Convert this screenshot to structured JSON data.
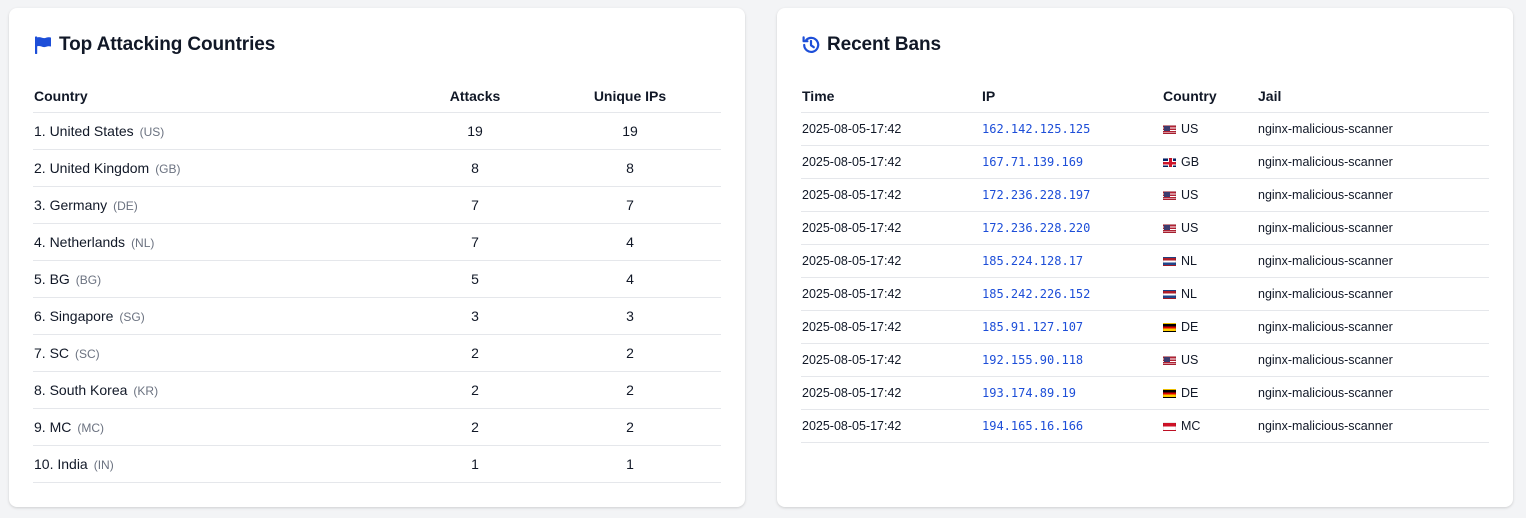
{
  "colors": {
    "accent": "#1d4ed8",
    "muted": "#6b7280",
    "border": "#e5e7eb",
    "background": "#f3f4f6"
  },
  "top_countries": {
    "title": "Top Attacking Countries",
    "icon": "flag-icon",
    "columns": [
      "Country",
      "Attacks",
      "Unique IPs"
    ],
    "rows": [
      {
        "name": "1. United States",
        "code": "(US)",
        "attacks": "19",
        "unique_ips": "19"
      },
      {
        "name": "2. United Kingdom",
        "code": "(GB)",
        "attacks": "8",
        "unique_ips": "8"
      },
      {
        "name": "3. Germany",
        "code": "(DE)",
        "attacks": "7",
        "unique_ips": "7"
      },
      {
        "name": "4. Netherlands",
        "code": "(NL)",
        "attacks": "7",
        "unique_ips": "4"
      },
      {
        "name": "5. BG",
        "code": "(BG)",
        "attacks": "5",
        "unique_ips": "4"
      },
      {
        "name": "6. Singapore",
        "code": "(SG)",
        "attacks": "3",
        "unique_ips": "3"
      },
      {
        "name": "7. SC",
        "code": "(SC)",
        "attacks": "2",
        "unique_ips": "2"
      },
      {
        "name": "8. South Korea",
        "code": "(KR)",
        "attacks": "2",
        "unique_ips": "2"
      },
      {
        "name": "9. MC",
        "code": "(MC)",
        "attacks": "2",
        "unique_ips": "2"
      },
      {
        "name": "10. India",
        "code": "(IN)",
        "attacks": "1",
        "unique_ips": "1"
      }
    ]
  },
  "recent_bans": {
    "title": "Recent Bans",
    "icon": "history-icon",
    "columns": [
      "Time",
      "IP",
      "Country",
      "Jail"
    ],
    "rows": [
      {
        "time": "2025-08-05-17:42",
        "ip": "162.142.125.125",
        "flag": "us-flag-icon",
        "country": "US",
        "jail": "nginx-malicious-scanner"
      },
      {
        "time": "2025-08-05-17:42",
        "ip": "167.71.139.169",
        "flag": "gb-flag-icon",
        "country": "GB",
        "jail": "nginx-malicious-scanner"
      },
      {
        "time": "2025-08-05-17:42",
        "ip": "172.236.228.197",
        "flag": "us-flag-icon",
        "country": "US",
        "jail": "nginx-malicious-scanner"
      },
      {
        "time": "2025-08-05-17:42",
        "ip": "172.236.228.220",
        "flag": "us-flag-icon",
        "country": "US",
        "jail": "nginx-malicious-scanner"
      },
      {
        "time": "2025-08-05-17:42",
        "ip": "185.224.128.17",
        "flag": "nl-flag-icon",
        "country": "NL",
        "jail": "nginx-malicious-scanner"
      },
      {
        "time": "2025-08-05-17:42",
        "ip": "185.242.226.152",
        "flag": "nl-flag-icon",
        "country": "NL",
        "jail": "nginx-malicious-scanner"
      },
      {
        "time": "2025-08-05-17:42",
        "ip": "185.91.127.107",
        "flag": "de-flag-icon",
        "country": "DE",
        "jail": "nginx-malicious-scanner"
      },
      {
        "time": "2025-08-05-17:42",
        "ip": "192.155.90.118",
        "flag": "us-flag-icon",
        "country": "US",
        "jail": "nginx-malicious-scanner"
      },
      {
        "time": "2025-08-05-17:42",
        "ip": "193.174.89.19",
        "flag": "de-flag-icon",
        "country": "DE",
        "jail": "nginx-malicious-scanner"
      },
      {
        "time": "2025-08-05-17:42",
        "ip": "194.165.16.166",
        "flag": "mc-flag-icon",
        "country": "MC",
        "jail": "nginx-malicious-scanner"
      }
    ]
  }
}
